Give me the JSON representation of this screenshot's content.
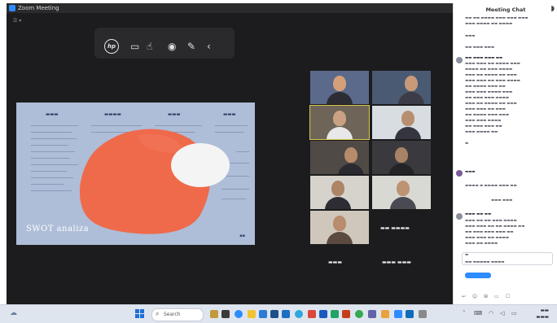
{
  "window": {
    "title": "Zoom Meeting"
  },
  "share_toolbar": {
    "icons": [
      "hp-logo-icon",
      "stop-share-icon",
      "pointer-icon",
      "spotlight-icon",
      "annotate-icon",
      "more-icon"
    ]
  },
  "slide": {
    "title": "SWOT analiza"
  },
  "chat": {
    "title": "Meeting Chat"
  },
  "taskbar": {
    "search_label": "Search"
  },
  "colors": {
    "stage_bg": "#1c1c1e",
    "slide_bg": "#aebdd8",
    "blob_orange": "#ef6a4a",
    "accent_blue": "#2d8cff"
  }
}
